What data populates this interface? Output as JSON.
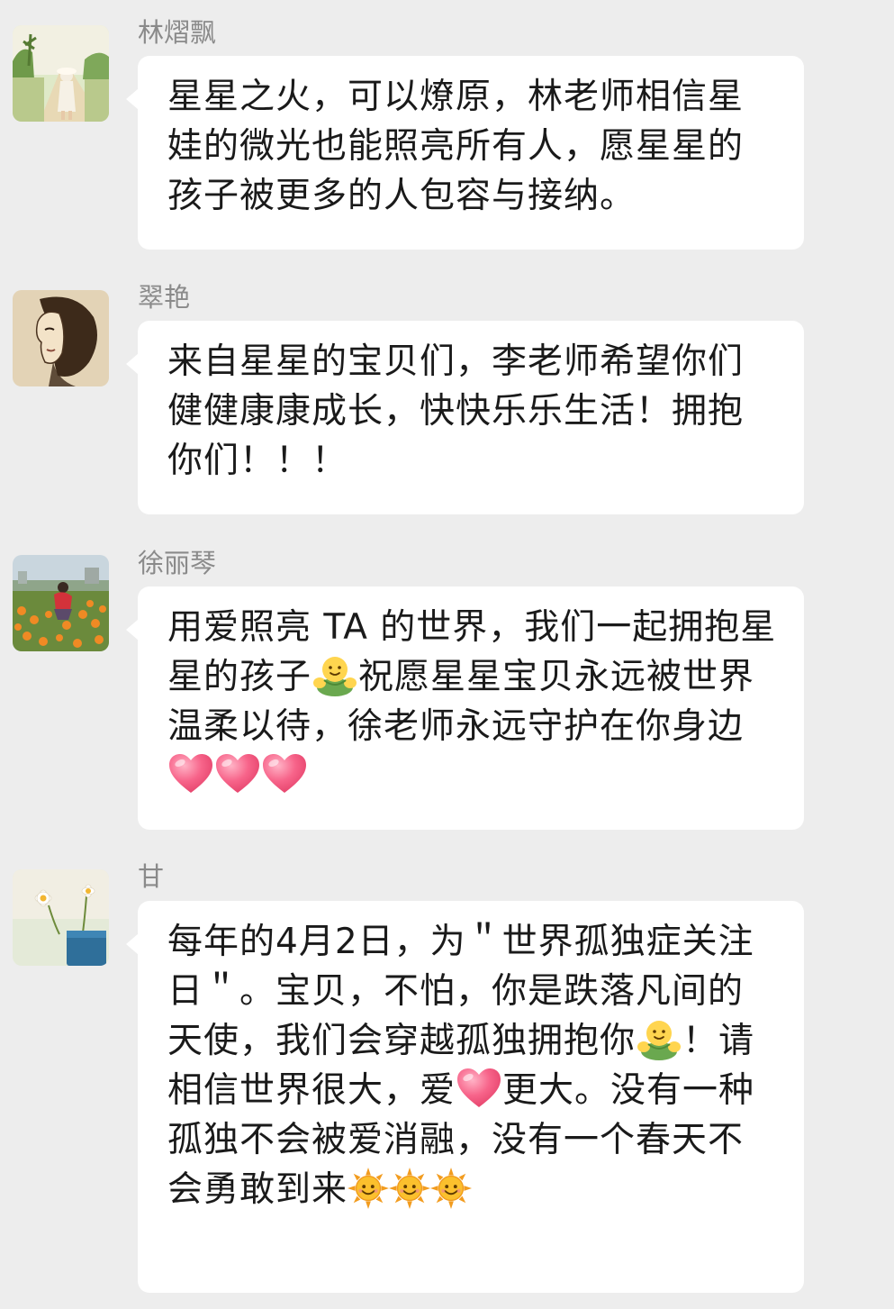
{
  "messages": [
    {
      "sender": "林熠飘",
      "avatar": "avatar-photo-woman-road-icon",
      "text": "星星之火，可以燎原，林老师相信星娃的微光也能照亮所有人，愿星星的孩子被更多的人包容与接纳。"
    },
    {
      "sender": "翠艳",
      "avatar": "avatar-sketch-portrait-icon",
      "text": "来自星星的宝贝们，李老师希望你们健健康康成长，快快乐乐生活！拥抱你们！！！"
    },
    {
      "sender": "徐丽琴",
      "avatar": "avatar-flower-field-icon",
      "text_parts": [
        "用爱照亮 TA 的世界，我们一起拥抱星星的孩子",
        "祝愿星星宝贝永远被世界温柔以待，徐老师永远守护在你身边"
      ]
    },
    {
      "sender": "甘",
      "avatar": "avatar-flowers-vase-icon",
      "text_parts": [
        "每年的4月2日，为＂世界孤独症关注日＂。宝贝，不怕，你是跌落凡间的天使，我们会穿越孤独拥抱你",
        "！请相信世界很大，爱",
        "更大。没有一种孤独不会被爱消融，没有一个春天不会勇敢到来"
      ]
    }
  ],
  "emojis": {
    "hug": "hug-emoji-icon",
    "heart": "heart-emoji-icon",
    "sun": "sun-emoji-icon"
  },
  "colors": {
    "background": "#ededed",
    "bubble": "#ffffff",
    "sender_name": "#8a8a8a",
    "text": "#1a1a1a",
    "heart": "#f2557a",
    "sun": "#f7b32b",
    "hug": "#8bc34a"
  }
}
